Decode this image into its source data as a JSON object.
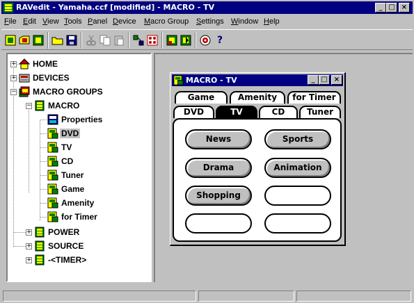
{
  "window": {
    "title": "RAVedit - Yamaha.ccf [modified] - MACRO - TV",
    "minimize": "_",
    "maximize": "□",
    "close": "×"
  },
  "menubar": [
    "File",
    "Edit",
    "View",
    "Tools",
    "Panel",
    "Device",
    "Macro Group",
    "Settings",
    "Window",
    "Help"
  ],
  "toolbar": {
    "icons": [
      "new-icon",
      "open-ccf-icon",
      "open-icon",
      "folder-icon",
      "save-icon",
      "cut-icon",
      "copy-icon",
      "paste-icon",
      "network-icon",
      "grid-icon",
      "green-icon-a",
      "green-icon-b",
      "target-icon",
      "help-icon"
    ],
    "help_glyph": "?"
  },
  "tree": {
    "home": "HOME",
    "devices": "DEVICES",
    "macro_groups": "MACRO GROUPS",
    "macro": "MACRO",
    "properties": "Properties",
    "dvd": "DVD",
    "tv": "TV",
    "cd": "CD",
    "tuner": "Tuner",
    "game": "Game",
    "amenity": "Amenity",
    "for_timer": "for Timer",
    "power": "POWER",
    "source": "SOURCE",
    "timer": "-<TIMER>",
    "selected": "DVD"
  },
  "child_window": {
    "title": "MACRO - TV",
    "tabs_back": [
      "Game",
      "Amenity",
      "for Timer"
    ],
    "tabs_front": [
      "DVD",
      "TV",
      "CD",
      "Tuner"
    ],
    "active_tab": "TV",
    "buttons": [
      "News",
      "Sports",
      "Drama",
      "Animation",
      "Shopping",
      "",
      "",
      ""
    ]
  },
  "colors": {
    "titlebar": "#000080",
    "face": "#c0c0c0"
  }
}
